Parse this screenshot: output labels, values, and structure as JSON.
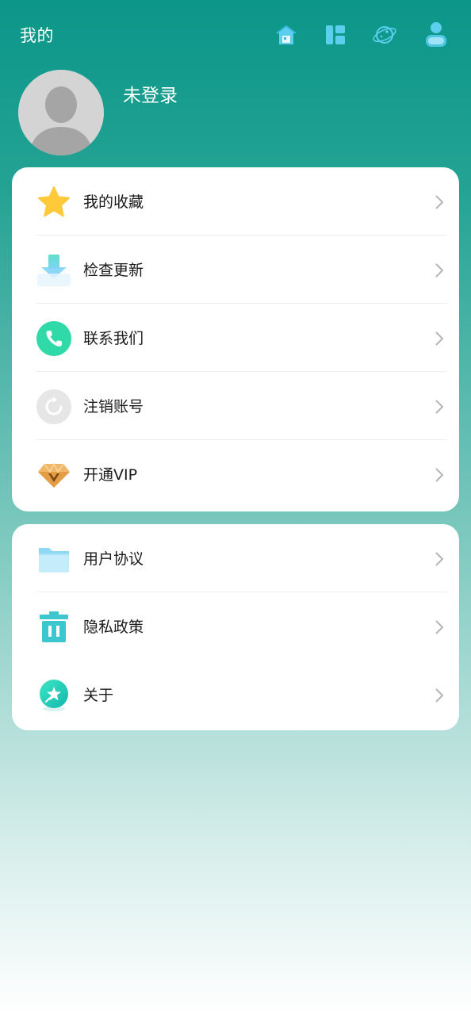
{
  "header": {
    "title": "我的",
    "nav_icons": [
      "home-icon",
      "dashboard-icon",
      "planet-icon",
      "user-icon"
    ]
  },
  "profile": {
    "username": "未登录",
    "avatar": "default-avatar"
  },
  "menu_group_1": [
    {
      "label": "我的收藏",
      "icon": "star-icon"
    },
    {
      "label": "检查更新",
      "icon": "download-icon"
    },
    {
      "label": "联系我们",
      "icon": "phone-icon"
    },
    {
      "label": "注销账号",
      "icon": "refresh-icon"
    },
    {
      "label": "开通VIP",
      "icon": "vip-diamond-icon"
    }
  ],
  "menu_group_2": [
    {
      "label": "用户协议",
      "icon": "folder-icon"
    },
    {
      "label": "隐私政策",
      "icon": "trash-icon"
    },
    {
      "label": "关于",
      "icon": "magic-star-icon"
    }
  ],
  "colors": {
    "primary": "#0b9689",
    "accent_icon": "#4fc6ec",
    "star": "#ffc93a",
    "phone": "#2fd9a8",
    "chevron": "#b5b5b5"
  }
}
